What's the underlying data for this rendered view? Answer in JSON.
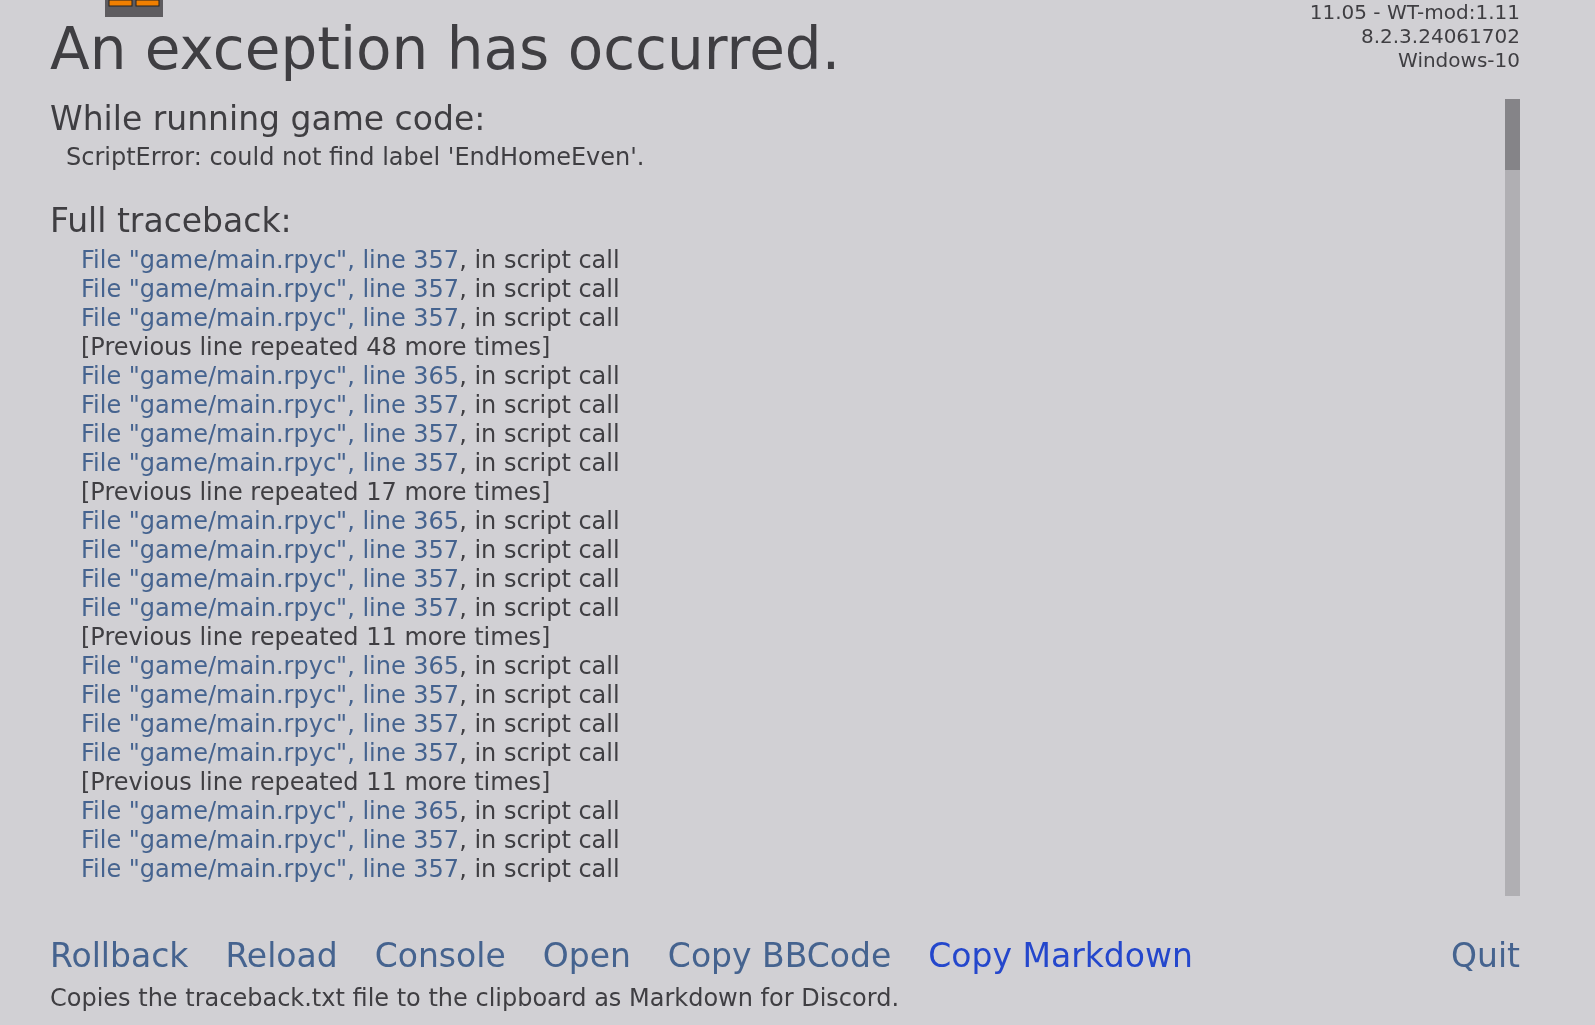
{
  "title": "An exception has occurred.",
  "version_info": [
    "11.05 - WT-mod:1.11",
    "8.2.3.24061702",
    "Windows-10"
  ],
  "error_heading": "While running game code:",
  "error_message": "ScriptError: could not find label 'EndHomeEven'.",
  "traceback_heading": "Full traceback:",
  "traceback": [
    {
      "kind": "frame",
      "location": "File \"game/main.rpyc\", line 357",
      "rest": ", in script call"
    },
    {
      "kind": "frame",
      "location": "File \"game/main.rpyc\", line 357",
      "rest": ", in script call"
    },
    {
      "kind": "frame",
      "location": "File \"game/main.rpyc\", line 357",
      "rest": ", in script call"
    },
    {
      "kind": "repeat",
      "text": "[Previous line repeated 48 more times]"
    },
    {
      "kind": "frame",
      "location": "File \"game/main.rpyc\", line 365",
      "rest": ", in script call"
    },
    {
      "kind": "frame",
      "location": "File \"game/main.rpyc\", line 357",
      "rest": ", in script call"
    },
    {
      "kind": "frame",
      "location": "File \"game/main.rpyc\", line 357",
      "rest": ", in script call"
    },
    {
      "kind": "frame",
      "location": "File \"game/main.rpyc\", line 357",
      "rest": ", in script call"
    },
    {
      "kind": "repeat",
      "text": "[Previous line repeated 17 more times]"
    },
    {
      "kind": "frame",
      "location": "File \"game/main.rpyc\", line 365",
      "rest": ", in script call"
    },
    {
      "kind": "frame",
      "location": "File \"game/main.rpyc\", line 357",
      "rest": ", in script call"
    },
    {
      "kind": "frame",
      "location": "File \"game/main.rpyc\", line 357",
      "rest": ", in script call"
    },
    {
      "kind": "frame",
      "location": "File \"game/main.rpyc\", line 357",
      "rest": ", in script call"
    },
    {
      "kind": "repeat",
      "text": "[Previous line repeated 11 more times]"
    },
    {
      "kind": "frame",
      "location": "File \"game/main.rpyc\", line 365",
      "rest": ", in script call"
    },
    {
      "kind": "frame",
      "location": "File \"game/main.rpyc\", line 357",
      "rest": ", in script call"
    },
    {
      "kind": "frame",
      "location": "File \"game/main.rpyc\", line 357",
      "rest": ", in script call"
    },
    {
      "kind": "frame",
      "location": "File \"game/main.rpyc\", line 357",
      "rest": ", in script call"
    },
    {
      "kind": "repeat",
      "text": "[Previous line repeated 11 more times]"
    },
    {
      "kind": "frame",
      "location": "File \"game/main.rpyc\", line 365",
      "rest": ", in script call"
    },
    {
      "kind": "frame",
      "location": "File \"game/main.rpyc\", line 357",
      "rest": ", in script call"
    },
    {
      "kind": "frame",
      "location": "File \"game/main.rpyc\", line 357",
      "rest": ", in script call"
    }
  ],
  "actions": [
    {
      "label": "Rollback",
      "selected": false
    },
    {
      "label": "Reload",
      "selected": false
    },
    {
      "label": "Console",
      "selected": false
    },
    {
      "label": "Open",
      "selected": false
    },
    {
      "label": "Copy BBCode",
      "selected": false
    },
    {
      "label": "Copy Markdown",
      "selected": true
    },
    {
      "label": "Quit",
      "selected": false
    }
  ],
  "status_text": "Copies the traceback.txt file to the clipboard as Markdown for Discord."
}
